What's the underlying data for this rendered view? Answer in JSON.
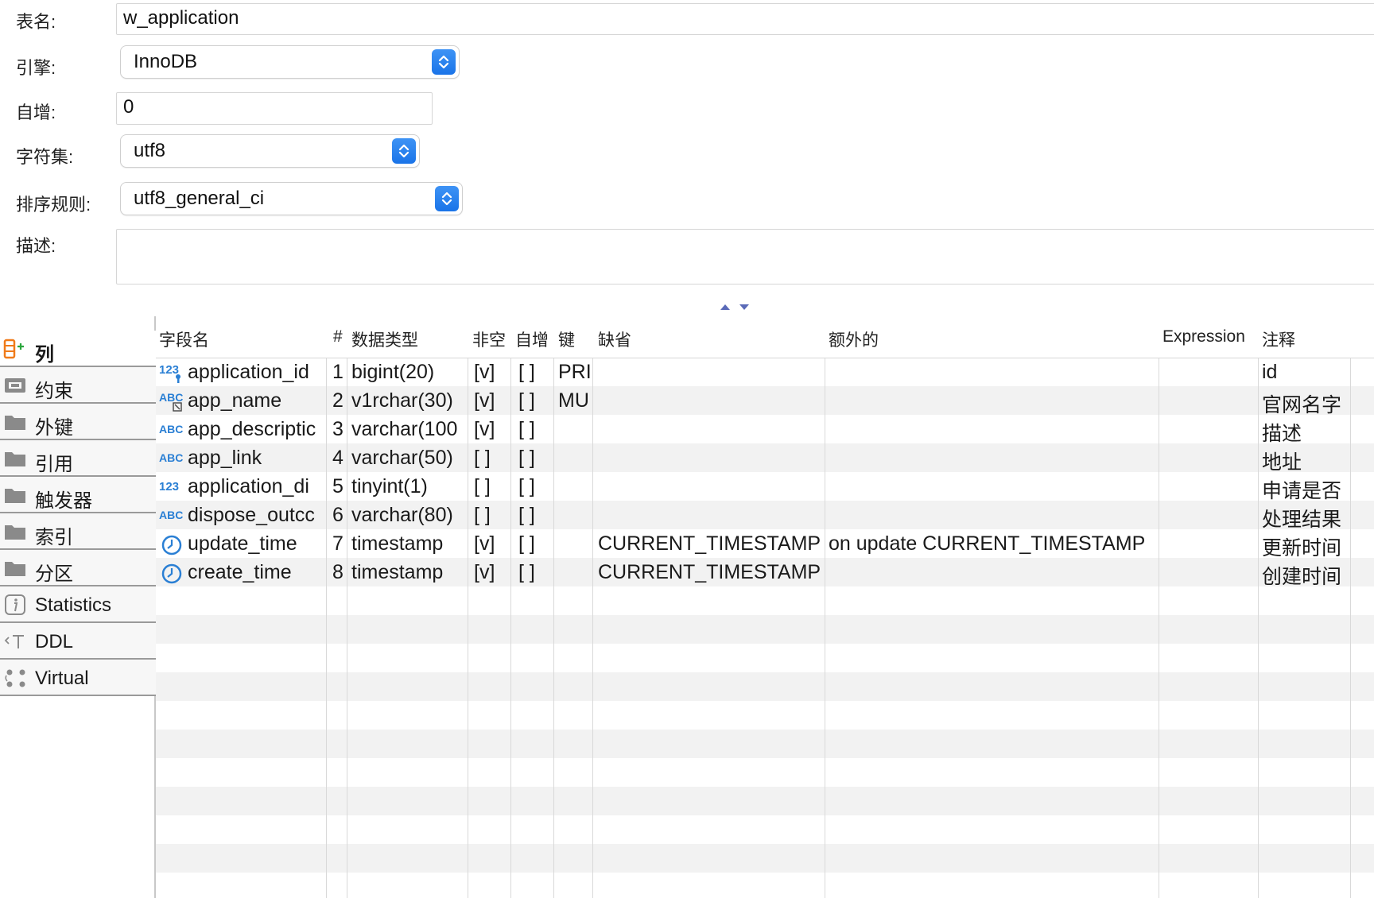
{
  "form": {
    "table_name": {
      "label": "表名:",
      "value": "w_application"
    },
    "engine": {
      "label": "引擎:",
      "value": "InnoDB"
    },
    "auto_increment": {
      "label": "自增:",
      "value": "0"
    },
    "charset": {
      "label": "字符集:",
      "value": "utf8"
    },
    "collation": {
      "label": "排序规则:",
      "value": "utf8_general_ci"
    },
    "description": {
      "label": "描述:",
      "value": ""
    }
  },
  "tabs": [
    {
      "label": "列",
      "icon": "columns-icon",
      "active": true
    },
    {
      "label": "约束",
      "icon": "constraint-icon"
    },
    {
      "label": "外键",
      "icon": "folder-icon"
    },
    {
      "label": "引用",
      "icon": "folder-icon"
    },
    {
      "label": "触发器",
      "icon": "folder-icon"
    },
    {
      "label": "索引",
      "icon": "folder-icon"
    },
    {
      "label": "分区",
      "icon": "folder-icon"
    },
    {
      "label": "Statistics",
      "icon": "info-icon"
    },
    {
      "label": "DDL",
      "icon": "ddl-icon"
    },
    {
      "label": "Virtual",
      "icon": "virtual-icon"
    }
  ],
  "columns_table": {
    "headers": [
      "字段名",
      "#",
      "数据类型",
      "非空",
      "自增",
      "键",
      "缺省",
      "额外的",
      "Expression",
      "注释"
    ],
    "rows": [
      {
        "icon": "numeric-key-icon",
        "name": "application_id",
        "num": "1",
        "type": "bigint(20)",
        "not_null": "[v]",
        "auto_inc": "[ ]",
        "key": "PRI",
        "default": "",
        "extra": "",
        "expression": "",
        "comment": "id"
      },
      {
        "icon": "text-unique-icon",
        "name": "app_name",
        "num": "2",
        "type": "v1rchar(30)",
        "not_null": "[v]",
        "auto_inc": "[ ]",
        "key": "MU",
        "default": "",
        "extra": "",
        "expression": "",
        "comment": "官网名字"
      },
      {
        "icon": "text-icon",
        "name": "app_descriptic",
        "num": "3",
        "type": "varchar(100",
        "not_null": "[v]",
        "auto_inc": "[ ]",
        "key": "",
        "default": "",
        "extra": "",
        "expression": "",
        "comment": "描述"
      },
      {
        "icon": "text-icon",
        "name": "app_link",
        "num": "4",
        "type": "varchar(50)",
        "not_null": "[ ]",
        "auto_inc": "[ ]",
        "key": "",
        "default": "",
        "extra": "",
        "expression": "",
        "comment": "地址"
      },
      {
        "icon": "numeric-icon",
        "name": "application_di",
        "num": "5",
        "type": "tinyint(1)",
        "not_null": "[ ]",
        "auto_inc": "[ ]",
        "key": "",
        "default": "",
        "extra": "",
        "expression": "",
        "comment": "申请是否"
      },
      {
        "icon": "text-icon",
        "name": "dispose_outcc",
        "num": "6",
        "type": "varchar(80)",
        "not_null": "[ ]",
        "auto_inc": "[ ]",
        "key": "",
        "default": "",
        "extra": "",
        "expression": "",
        "comment": "处理结果"
      },
      {
        "icon": "clock-icon",
        "name": "update_time",
        "num": "7",
        "type": "timestamp",
        "not_null": "[v]",
        "auto_inc": "[ ]",
        "key": "",
        "default": "CURRENT_TIMESTAMP",
        "extra": "on update CURRENT_TIMESTAMP",
        "expression": "",
        "comment": "更新时间"
      },
      {
        "icon": "clock-icon",
        "name": "create_time",
        "num": "8",
        "type": "timestamp",
        "not_null": "[v]",
        "auto_inc": "[ ]",
        "key": "",
        "default": "CURRENT_TIMESTAMP",
        "extra": "",
        "expression": "",
        "comment": "创建时间"
      }
    ]
  },
  "colors": {
    "accent": "#1a74e8",
    "stripe": "#f2f2f2",
    "numeric_icon": "#2a7fd4",
    "tab_active_icon": "#f07b1a"
  }
}
